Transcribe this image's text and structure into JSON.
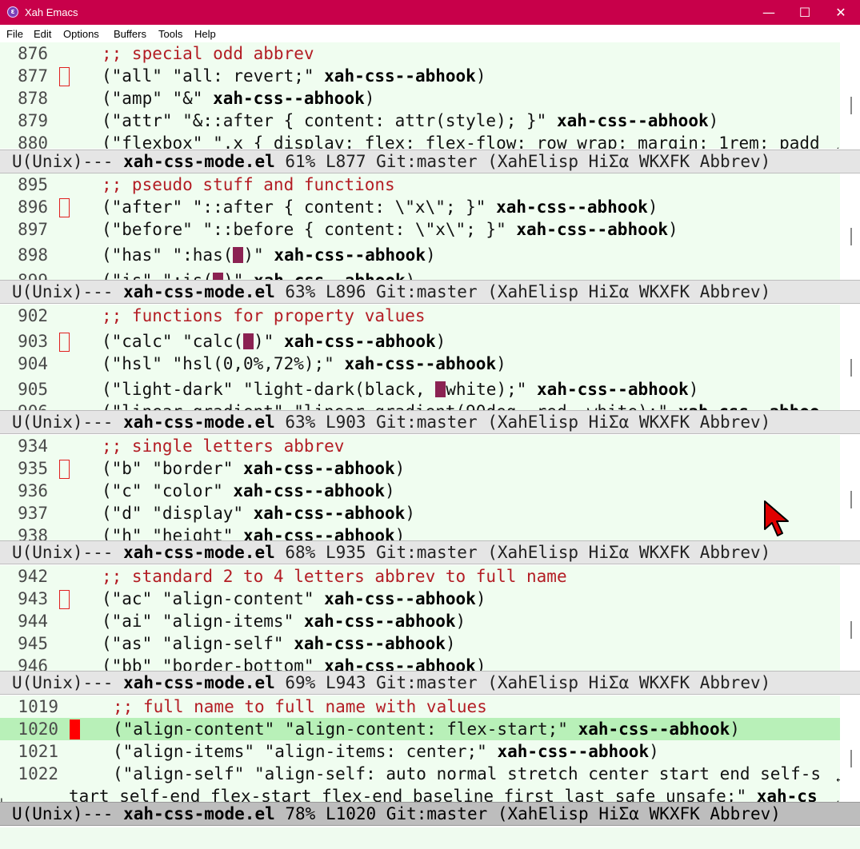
{
  "window": {
    "title": "Xah Emacs",
    "icon_letter": "ε",
    "buttons": {
      "minimize": "—",
      "maximize": "☐",
      "close": "✕"
    }
  },
  "menu": {
    "items": [
      "File",
      "Edit",
      "Options",
      "Buffers",
      "Tools",
      "Help"
    ]
  },
  "icons": {
    "fringe_continuation": "continuation-arrow-icon",
    "mouse": "mouse-pointer-icon"
  },
  "colors": {
    "titlebar": "#c8004a",
    "buffer_bg": "#f0fdf0",
    "comment": "#b31d24",
    "highlight_line": "#b8f0b8",
    "cursor": "#ff0000"
  },
  "windows": [
    {
      "lines": [
        {
          "num": "876",
          "code": ";; special odd abbrev"
        },
        {
          "num": "877",
          "code": "(\"all\" \"all: revert;\" xah-css--abhook)"
        },
        {
          "num": "878",
          "code": "(\"amp\" \"&\" xah-css--abhook)"
        },
        {
          "num": "879",
          "code": "(\"attr\" \"&::after { content: attr(style); }\" xah-css--abhook)"
        },
        {
          "num": "880",
          "code": "(\"flexbox\" \".x { display: flex; flex-flow: row wrap; margin: 1rem; padd"
        }
      ],
      "modeline": {
        "pre": "U(Unix)--- ",
        "buffer": "xah-css-mode.el",
        "post": " 61% L877 Git:master (XahElisp HiΣα WKXFK Abbrev)"
      }
    },
    {
      "lines": [
        {
          "num": "895",
          "code": ";; pseudo stuff and functions"
        },
        {
          "num": "896",
          "code": "(\"after\" \"::after { content: \\\"x\\\"; }\" xah-css--abhook)"
        },
        {
          "num": "897",
          "code": "(\"before\" \"::before { content: \\\"x\\\"; }\" xah-css--abhook)"
        },
        {
          "num": "898",
          "code": "(\"has\" \":has(▮)\" xah-css--abhook)"
        },
        {
          "num": "899",
          "code": "(\"is\" \":is(▮)\" xah-css--abhook)"
        }
      ],
      "modeline": {
        "pre": "U(Unix)--- ",
        "buffer": "xah-css-mode.el",
        "post": " 63% L896 Git:master (XahElisp HiΣα WKXFK Abbrev)"
      }
    },
    {
      "lines": [
        {
          "num": "902",
          "code": ";; functions for property values"
        },
        {
          "num": "903",
          "code": "(\"calc\" \"calc(▮)\" xah-css--abhook)"
        },
        {
          "num": "904",
          "code": "(\"hsl\" \"hsl(0,0%,72%);\" xah-css--abhook)"
        },
        {
          "num": "905",
          "code": "(\"light-dark\" \"light-dark(black, ▮white);\" xah-css--abhook)"
        },
        {
          "num": "906",
          "code": "(\"linear-gradient\" \"linear-gradient(90deg, red, white);\" xah-css--abhoo"
        }
      ],
      "modeline": {
        "pre": "U(Unix)--- ",
        "buffer": "xah-css-mode.el",
        "post": " 63% L903 Git:master (XahElisp HiΣα WKXFK Abbrev)"
      }
    },
    {
      "lines": [
        {
          "num": "934",
          "code": ";; single letters abbrev"
        },
        {
          "num": "935",
          "code": "(\"b\" \"border\" xah-css--abhook)"
        },
        {
          "num": "936",
          "code": "(\"c\" \"color\" xah-css--abhook)"
        },
        {
          "num": "937",
          "code": "(\"d\" \"display\" xah-css--abhook)"
        },
        {
          "num": "938",
          "code": "(\"h\" \"height\" xah-css--abhook)"
        }
      ],
      "modeline": {
        "pre": "U(Unix)--- ",
        "buffer": "xah-css-mode.el",
        "post": " 68% L935 Git:master (XahElisp HiΣα WKXFK Abbrev)"
      }
    },
    {
      "lines": [
        {
          "num": "942",
          "code": ";; standard 2 to 4 letters abbrev to full name"
        },
        {
          "num": "943",
          "code": "(\"ac\" \"align-content\" xah-css--abhook)"
        },
        {
          "num": "944",
          "code": "(\"ai\" \"align-items\" xah-css--abhook)"
        },
        {
          "num": "945",
          "code": "(\"as\" \"align-self\" xah-css--abhook)"
        },
        {
          "num": "946",
          "code": "(\"bb\" \"border-bottom\" xah-css--abhook)"
        }
      ],
      "modeline": {
        "pre": "U(Unix)--- ",
        "buffer": "xah-css-mode.el",
        "post": " 69% L943 Git:master (XahElisp HiΣα WKXFK Abbrev)"
      }
    },
    {
      "lines": [
        {
          "num": "1019",
          "code": ";; full name to full name with values"
        },
        {
          "num": "1020",
          "code": "(\"align-content\" \"align-content: flex-start;\" xah-css--abhook)"
        },
        {
          "num": "1021",
          "code": "(\"align-items\" \"align-items: center;\" xah-css--abhook)"
        },
        {
          "num": "1022",
          "code": "(\"align-self\" \"align-self: auto normal stretch center start end self-s"
        },
        {
          "num": "",
          "code": "tart self-end flex-start flex-end baseline first last safe unsafe;\" xah-cs"
        }
      ],
      "modeline": {
        "pre": "U(Unix)--- ",
        "buffer": "xah-css-mode.el",
        "post": " 78% L1020 Git:master (XahElisp HiΣα WKXFK Abbrev)"
      }
    }
  ]
}
